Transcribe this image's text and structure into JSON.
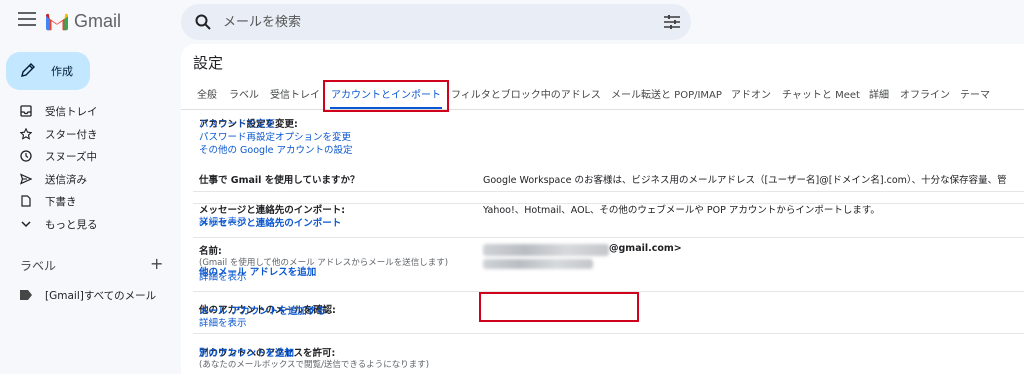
{
  "app": {
    "name": "Gmail"
  },
  "search": {
    "placeholder": "メールを検索"
  },
  "compose": {
    "label": "作成"
  },
  "nav": [
    {
      "label": "受信トレイ",
      "icon": "inbox-icon"
    },
    {
      "label": "スター付き",
      "icon": "star-icon"
    },
    {
      "label": "スヌーズ中",
      "icon": "clock-icon"
    },
    {
      "label": "送信済み",
      "icon": "send-icon"
    },
    {
      "label": "下書き",
      "icon": "draft-icon"
    },
    {
      "label": "もっと見る",
      "icon": "chevron-down-icon"
    }
  ],
  "labels": {
    "heading": "ラベル",
    "add": "+",
    "items": [
      {
        "label": "[Gmail]すべてのメール",
        "icon": "label-icon"
      }
    ]
  },
  "settings": {
    "title": "設定",
    "tabs": [
      "全般",
      "ラベル",
      "受信トレイ",
      "アカウントとインポート",
      "フィルタとブロック中のアドレス",
      "メール転送と POP/IMAP",
      "アドオン",
      "チャットと Meet",
      "詳細",
      "オフライン",
      "テーマ"
    ],
    "active_tab": "アカウントとインポート",
    "rows": {
      "change_account": {
        "label": "アカウント設定を変更:",
        "links": [
          "パスワードを変更",
          "パスワード再設定オプションを変更",
          "その他の Google アカウントの設定"
        ]
      },
      "work": {
        "label": "仕事で Gmail を使用していますか？",
        "text": "Google Workspace のお客様は、ビジネス用のメールアドレス（[ユーザー名]@[ドメイン名].com）、十分な保存容量、管"
      },
      "import": {
        "label": "メッセージと連絡先のインポート:",
        "details": "詳細を表示",
        "text": "Yahoo!、Hotmail、AOL、その他のウェブメールや POP アカウントからインポートします。",
        "action": "メッセージと連絡先のインポート"
      },
      "name": {
        "label": "名前:",
        "sub": "(Gmail を使用して他のメール アドレスからメールを送信します)",
        "details": "詳細を表示",
        "email_suffix": "@gmail.com>",
        "action": "他のメール アドレスを追加"
      },
      "check_mail": {
        "label": "他のアカウントのメールを確認:",
        "details": "詳細を表示",
        "action": "メール アカウントを追加する"
      },
      "grant_access": {
        "label": "アカウントへのアクセスを許可:",
        "sub": "(あなたのメールボックスで閲覧/送信できるようになります)",
        "action": "別のアカウントを追加"
      }
    }
  },
  "colors": {
    "accent": "#0b57d0",
    "compose_bg": "#c2e7ff",
    "highlight": "#d0021b"
  }
}
